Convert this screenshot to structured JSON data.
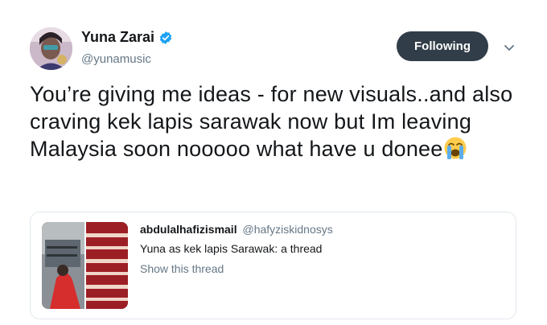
{
  "tweet": {
    "author": {
      "display_name": "Yuna Zarai",
      "handle": "@yunamusic",
      "verified": true
    },
    "follow_button_label": "Following",
    "text": "You’re giving me ideas - for new visuals..and also craving kek lapis sarawak now but Im leaving Malaysia soon nooooo what have u donee",
    "emoji": "loudly-crying-face"
  },
  "quoted_tweet": {
    "display_name": "abdulalhafizismail",
    "handle": "@hafyziskidnosys",
    "text": "Yuna as kek lapis Sarawak: a thread",
    "link_label": "Show this thread"
  },
  "colors": {
    "accent_blue": "#1da1f2",
    "button_dark": "#313d48",
    "muted_text": "#657786",
    "border": "#e1e8ed"
  }
}
